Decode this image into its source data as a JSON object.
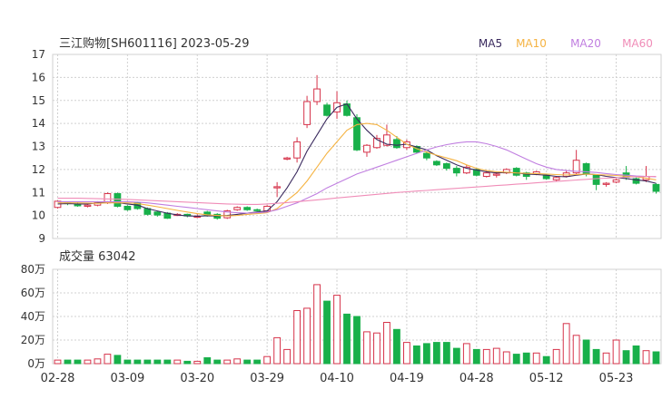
{
  "header": {
    "title": "三江购物[SH601116] 2023-05-29"
  },
  "legend": [
    {
      "name": "MA5",
      "color": "#3a2a5e"
    },
    {
      "name": "MA10",
      "color": "#f5b342"
    },
    {
      "name": "MA20",
      "color": "#c07ee0"
    },
    {
      "name": "MA60",
      "color": "#f08db8"
    }
  ],
  "volume_panel": {
    "label": "成交量 63042"
  },
  "colors": {
    "up": "#d6334a",
    "down": "#18b04a",
    "grid": "#d0d0d0"
  },
  "chart_data": [
    {
      "type": "candlestick",
      "title": "三江购物[SH601116] 2023-05-29",
      "ylim": [
        9,
        17
      ],
      "yticks": [
        9,
        10,
        11,
        12,
        13,
        14,
        15,
        16,
        17
      ],
      "grid": true,
      "legend_position": "top-right",
      "x": [
        "02-28",
        "03-01",
        "03-02",
        "03-03",
        "03-06",
        "03-07",
        "03-08",
        "03-09",
        "03-10",
        "03-13",
        "03-14",
        "03-15",
        "03-16",
        "03-17",
        "03-20",
        "03-21",
        "03-22",
        "03-23",
        "03-24",
        "03-27",
        "03-28",
        "03-29",
        "03-30",
        "03-31",
        "04-03",
        "04-04",
        "04-06",
        "04-07",
        "04-10",
        "04-11",
        "04-12",
        "04-13",
        "04-14",
        "04-17",
        "04-18",
        "04-19",
        "04-20",
        "04-21",
        "04-24",
        "04-25",
        "04-26",
        "04-27",
        "04-28",
        "05-04",
        "05-05",
        "05-08",
        "05-09",
        "05-10",
        "05-11",
        "05-12",
        "05-15",
        "05-16",
        "05-17",
        "05-18",
        "05-19",
        "05-22",
        "05-23",
        "05-24",
        "05-25",
        "05-26",
        "05-29"
      ],
      "xticks": [
        "02-28",
        "03-09",
        "03-20",
        "03-29",
        "04-10",
        "04-19",
        "04-28",
        "05-12",
        "05-23"
      ],
      "ohlc": [
        [
          10.35,
          10.62,
          10.3,
          10.65
        ],
        [
          10.55,
          10.52,
          10.45,
          10.6
        ],
        [
          10.5,
          10.42,
          10.38,
          10.58
        ],
        [
          10.4,
          10.45,
          10.35,
          10.52
        ],
        [
          10.45,
          10.58,
          10.4,
          10.62
        ],
        [
          10.55,
          10.95,
          10.5,
          11.0
        ],
        [
          10.95,
          10.4,
          10.35,
          11.0
        ],
        [
          10.4,
          10.25,
          10.2,
          10.45
        ],
        [
          10.55,
          10.3,
          10.25,
          10.6
        ],
        [
          10.3,
          10.05,
          10.0,
          10.35
        ],
        [
          10.15,
          10.02,
          9.95,
          10.2
        ],
        [
          10.1,
          9.88,
          9.85,
          10.15
        ],
        [
          10.0,
          10.05,
          9.98,
          10.1
        ],
        [
          10.05,
          9.98,
          9.92,
          10.08
        ],
        [
          9.95,
          9.96,
          9.9,
          10.05
        ],
        [
          10.15,
          10.0,
          9.95,
          10.2
        ],
        [
          10.05,
          9.88,
          9.82,
          10.1
        ],
        [
          9.9,
          10.2,
          9.85,
          10.25
        ],
        [
          10.25,
          10.35,
          10.2,
          10.4
        ],
        [
          10.35,
          10.25,
          10.2,
          10.4
        ],
        [
          10.25,
          10.22,
          10.18,
          10.3
        ],
        [
          10.2,
          10.4,
          10.15,
          10.45
        ],
        [
          11.2,
          11.25,
          10.8,
          11.45
        ],
        [
          12.45,
          12.5,
          12.4,
          12.55
        ],
        [
          12.5,
          13.2,
          12.3,
          13.4
        ],
        [
          13.95,
          14.95,
          13.8,
          15.2
        ],
        [
          14.95,
          15.5,
          14.8,
          16.1
        ],
        [
          14.8,
          14.35,
          14.3,
          14.9
        ],
        [
          14.5,
          14.9,
          14.2,
          15.4
        ],
        [
          14.85,
          14.35,
          14.3,
          15.0
        ],
        [
          14.25,
          12.85,
          12.8,
          14.4
        ],
        [
          12.75,
          13.05,
          12.55,
          13.1
        ],
        [
          12.95,
          13.35,
          12.9,
          13.5
        ],
        [
          13.05,
          13.5,
          13.0,
          13.95
        ],
        [
          13.3,
          12.95,
          12.9,
          13.45
        ],
        [
          12.95,
          13.2,
          12.85,
          13.3
        ],
        [
          13.0,
          12.75,
          12.7,
          13.05
        ],
        [
          12.7,
          12.5,
          12.4,
          12.8
        ],
        [
          12.35,
          12.2,
          12.15,
          12.4
        ],
        [
          12.25,
          12.05,
          11.95,
          12.3
        ],
        [
          12.05,
          11.85,
          11.7,
          12.15
        ],
        [
          11.85,
          12.1,
          11.8,
          12.2
        ],
        [
          12.0,
          11.75,
          11.7,
          12.05
        ],
        [
          11.7,
          11.85,
          11.65,
          11.95
        ],
        [
          11.75,
          11.8,
          11.65,
          11.9
        ],
        [
          11.85,
          12.0,
          11.8,
          12.05
        ],
        [
          12.05,
          11.75,
          11.7,
          12.1
        ],
        [
          11.85,
          11.7,
          11.55,
          11.9
        ],
        [
          11.8,
          11.9,
          11.75,
          11.95
        ],
        [
          11.75,
          11.6,
          11.55,
          11.8
        ],
        [
          11.55,
          11.65,
          11.5,
          11.7
        ],
        [
          11.7,
          11.85,
          11.65,
          11.95
        ],
        [
          11.85,
          12.4,
          11.8,
          12.85
        ],
        [
          12.25,
          11.8,
          11.7,
          12.3
        ],
        [
          11.75,
          11.35,
          11.1,
          11.8
        ],
        [
          11.35,
          11.4,
          11.25,
          11.45
        ],
        [
          11.45,
          11.55,
          11.4,
          11.6
        ],
        [
          11.85,
          11.65,
          11.55,
          12.15
        ],
        [
          11.6,
          11.4,
          11.35,
          11.65
        ],
        [
          11.55,
          11.7,
          11.45,
          12.15
        ],
        [
          11.35,
          11.05,
          10.95,
          11.4
        ]
      ],
      "ma": {
        "MA5": [
          10.5,
          10.52,
          10.5,
          10.5,
          10.55,
          10.6,
          10.56,
          10.5,
          10.45,
          10.3,
          10.2,
          10.1,
          10.02,
          9.98,
          9.97,
          9.99,
          9.98,
          10.0,
          10.05,
          10.1,
          10.15,
          10.2,
          10.6,
          11.2,
          11.9,
          12.8,
          13.5,
          14.2,
          14.7,
          14.85,
          14.2,
          13.7,
          13.3,
          13.1,
          13.05,
          13.1,
          12.98,
          12.85,
          12.6,
          12.4,
          12.2,
          12.05,
          11.98,
          11.9,
          11.85,
          11.87,
          11.85,
          11.8,
          11.78,
          11.75,
          11.7,
          11.68,
          11.75,
          11.8,
          11.78,
          11.7,
          11.65,
          11.6,
          11.55,
          11.5,
          11.4
        ],
        "MA10": [
          10.55,
          10.55,
          10.55,
          10.54,
          10.53,
          10.55,
          10.55,
          10.55,
          10.52,
          10.45,
          10.38,
          10.3,
          10.22,
          10.15,
          10.08,
          10.03,
          10.0,
          9.98,
          10.0,
          10.05,
          10.08,
          10.12,
          10.3,
          10.65,
          11.0,
          11.5,
          12.1,
          12.7,
          13.2,
          13.7,
          13.95,
          14.0,
          13.95,
          13.7,
          13.4,
          13.1,
          12.9,
          12.75,
          12.62,
          12.5,
          12.38,
          12.2,
          12.05,
          11.95,
          11.9,
          11.88,
          11.85,
          11.83,
          11.82,
          11.8,
          11.78,
          11.76,
          11.78,
          11.8,
          11.78,
          11.76,
          11.74,
          11.7,
          11.68,
          11.62,
          11.55
        ],
        "MA20": [
          10.6,
          10.6,
          10.6,
          10.6,
          10.6,
          10.6,
          10.6,
          10.6,
          10.58,
          10.55,
          10.5,
          10.45,
          10.4,
          10.35,
          10.3,
          10.25,
          10.2,
          10.15,
          10.12,
          10.1,
          10.12,
          10.15,
          10.25,
          10.4,
          10.55,
          10.75,
          10.95,
          11.2,
          11.4,
          11.6,
          11.8,
          11.95,
          12.1,
          12.25,
          12.4,
          12.55,
          12.7,
          12.85,
          12.98,
          13.08,
          13.15,
          13.2,
          13.2,
          13.12,
          13.0,
          12.85,
          12.65,
          12.45,
          12.25,
          12.1,
          12.0,
          11.95,
          11.92,
          11.9,
          11.87,
          11.82,
          11.78,
          11.75,
          11.72,
          11.7,
          11.68
        ],
        "MA60": [
          10.75,
          10.75,
          10.75,
          10.74,
          10.73,
          10.72,
          10.71,
          10.7,
          10.68,
          10.66,
          10.64,
          10.62,
          10.6,
          10.58,
          10.56,
          10.54,
          10.52,
          10.5,
          10.49,
          10.48,
          10.48,
          10.5,
          10.53,
          10.56,
          10.6,
          10.64,
          10.68,
          10.72,
          10.76,
          10.8,
          10.84,
          10.88,
          10.92,
          10.96,
          11.0,
          11.03,
          11.06,
          11.09,
          11.12,
          11.15,
          11.18,
          11.21,
          11.24,
          11.27,
          11.3,
          11.33,
          11.36,
          11.39,
          11.42,
          11.45,
          11.48,
          11.51,
          11.54,
          11.57,
          11.6,
          11.62,
          11.64,
          11.66,
          11.68,
          11.69,
          11.7
        ]
      }
    },
    {
      "type": "bar",
      "title": "成交量 63042",
      "ylim": [
        0,
        80
      ],
      "ytick_labels": [
        "0万",
        "20万",
        "40万",
        "60万",
        "80万"
      ],
      "yticks": [
        0,
        20,
        40,
        60,
        80
      ],
      "categories_ref": "same as candlestick x",
      "values": [
        3,
        3,
        3,
        3,
        4,
        8,
        7,
        3,
        3,
        3,
        3,
        3,
        3,
        2,
        2,
        5,
        3,
        3,
        4,
        3,
        3,
        6,
        22,
        12,
        45,
        47,
        67,
        53,
        58,
        42,
        40,
        27,
        26,
        35,
        29,
        18,
        15,
        17,
        18,
        18,
        13,
        17,
        12,
        12,
        13,
        10,
        8,
        9,
        9,
        6,
        12,
        34,
        24,
        20,
        12,
        9,
        20,
        11,
        15,
        11,
        10,
        6
      ]
    }
  ]
}
